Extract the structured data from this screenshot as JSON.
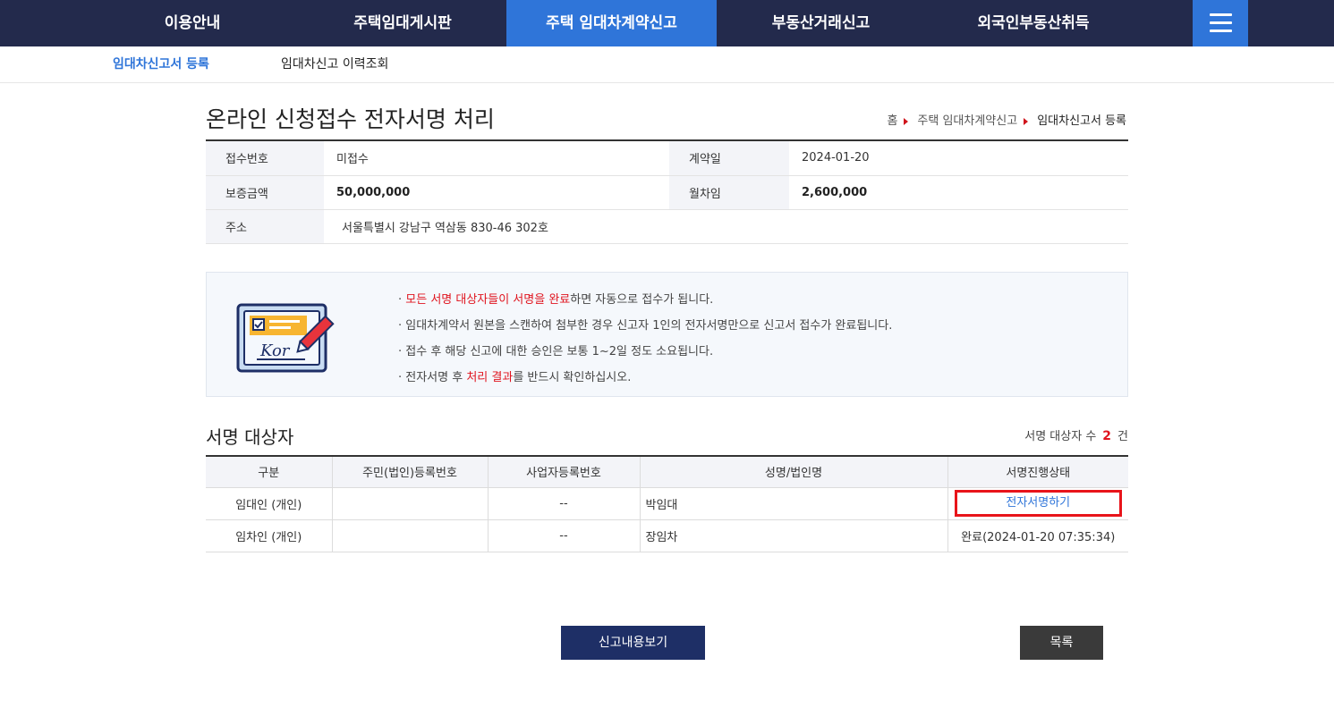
{
  "topnav": {
    "items": [
      {
        "label": "이용안내"
      },
      {
        "label": "주택임대게시판"
      },
      {
        "label": "주택 임대차계약신고",
        "active": true
      },
      {
        "label": "부동산거래신고"
      },
      {
        "label": "외국인부동산취득"
      }
    ],
    "menu_icon": "hamburger-icon",
    "active_color": "#2f75d9",
    "bg_color": "#232a4c"
  },
  "subnav": {
    "items": [
      {
        "label": "임대차신고서 등록",
        "active": true
      },
      {
        "label": "임대차신고 이력조회"
      }
    ]
  },
  "page": {
    "title": "온라인 신청접수 전자서명 처리",
    "breadcrumb": [
      "홈",
      "주택 임대차계약신고",
      "임대차신고서 등록"
    ]
  },
  "info": {
    "receipt_no_label": "접수번호",
    "receipt_no_value": "미접수",
    "contract_date_label": "계약일",
    "contract_date_value": "2024-01-20",
    "deposit_label": "보증금액",
    "deposit_value": "50,000,000",
    "monthly_rent_label": "월차임",
    "monthly_rent_value": "2,600,000",
    "address_label": "주소",
    "address_value": "서울특별시 강남구 역삼동 830-46 302호"
  },
  "notice": {
    "icon": "e-signature-document-icon",
    "icon_text": "Kor",
    "lines": [
      {
        "prefix": "· ",
        "highlight": "모든 서명 대상자들이 서명을 완료",
        "rest": "하면 자동으로 접수가 됩니다."
      },
      {
        "prefix": "· ",
        "highlight": "",
        "rest": "임대차계약서 원본을 스캔하여 첨부한 경우 신고자 1인의 전자서명만으로 신고서 접수가 완료됩니다."
      },
      {
        "prefix": "· ",
        "highlight": "",
        "rest": "접수 후 해당 신고에 대한 승인은 보통 1~2일 정도 소요됩니다."
      },
      {
        "prefix": "· 전자서명 후 ",
        "highlight": "처리 결과",
        "rest": "를 반드시 확인하십시오."
      }
    ]
  },
  "signers": {
    "title": "서명 대상자",
    "count_label": "서명 대상자 수",
    "count": "2",
    "count_unit": "건",
    "headers": [
      "구분",
      "주민(법인)등록번호",
      "사업자등록번호",
      "성명/법인명",
      "서명진행상태"
    ],
    "rows": [
      {
        "type": "임대인 (개인)",
        "resident_no": "",
        "business_no": "--",
        "name": "박임대",
        "status": "전자서명하기",
        "status_is_button": true
      },
      {
        "type": "임차인 (개인)",
        "resident_no": "",
        "business_no": "--",
        "name": "장임차",
        "status": "완료(2024-01-20 07:35:34)",
        "status_is_button": false
      }
    ]
  },
  "buttons": {
    "view_label": "신고내용보기",
    "list_label": "목록"
  }
}
